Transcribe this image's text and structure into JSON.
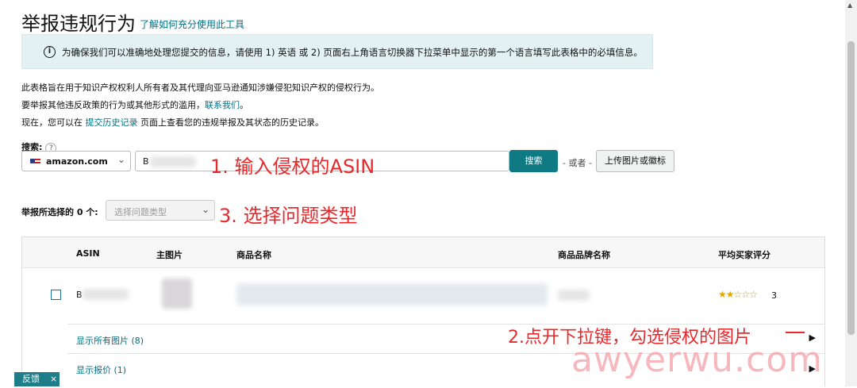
{
  "page": {
    "title": "举报违规行为",
    "help_link": "了解如何充分使用此工具",
    "info_text": "为确保我们可以准确地处理您提交的信息，请使用 1) 英语 或 2) 页面右上角语言切换器下拉菜单中显示的第一个语言填写此表格中的必填信息。"
  },
  "intro": {
    "line1": "此表格旨在用于知识产权权利人所有者及其代理向亚马逊通知涉嫌侵犯知识产权的侵权行为。",
    "line2_prefix": "要举报其他违反政策的行为或其他形式的滥用，",
    "line2_link": "联系我们",
    "line2_suffix": "。",
    "line3_prefix": "现在，您可以在 ",
    "line3_link": "提交历史记录",
    "line3_suffix": " 页面上查看您的违规举报及其状态的历史记录。"
  },
  "search": {
    "label": "搜索:",
    "help_glyph": "?",
    "marketplace": "amazon.com",
    "input_value": "B",
    "button": "搜索",
    "or_text": "- 或者 -",
    "upload_button": "上传图片或徽标"
  },
  "report": {
    "label": "举报所选择的 0 个:",
    "issue_placeholder": "选择问题类型"
  },
  "table": {
    "headers": [
      "ASIN",
      "主图片",
      "商品名称",
      "商品品牌名称",
      "平均买家评分"
    ],
    "row": {
      "asin": "B",
      "rating_value": 2.5,
      "rating_count": "3"
    },
    "show_images": "显示所有图片 (8)",
    "show_offers": "显示报价 (1)"
  },
  "annotations": {
    "a1": "1. 输入侵权的ASIN",
    "a2": "2.点开下拉键，勾选侵权的图片",
    "a3": "3. 选择问题类型"
  },
  "feedback": {
    "label": "反馈",
    "close": "×"
  },
  "watermark": "awyerwu.com",
  "colors": {
    "accent": "#0f7a84",
    "link": "#007185",
    "annotation": "#e8282b"
  }
}
